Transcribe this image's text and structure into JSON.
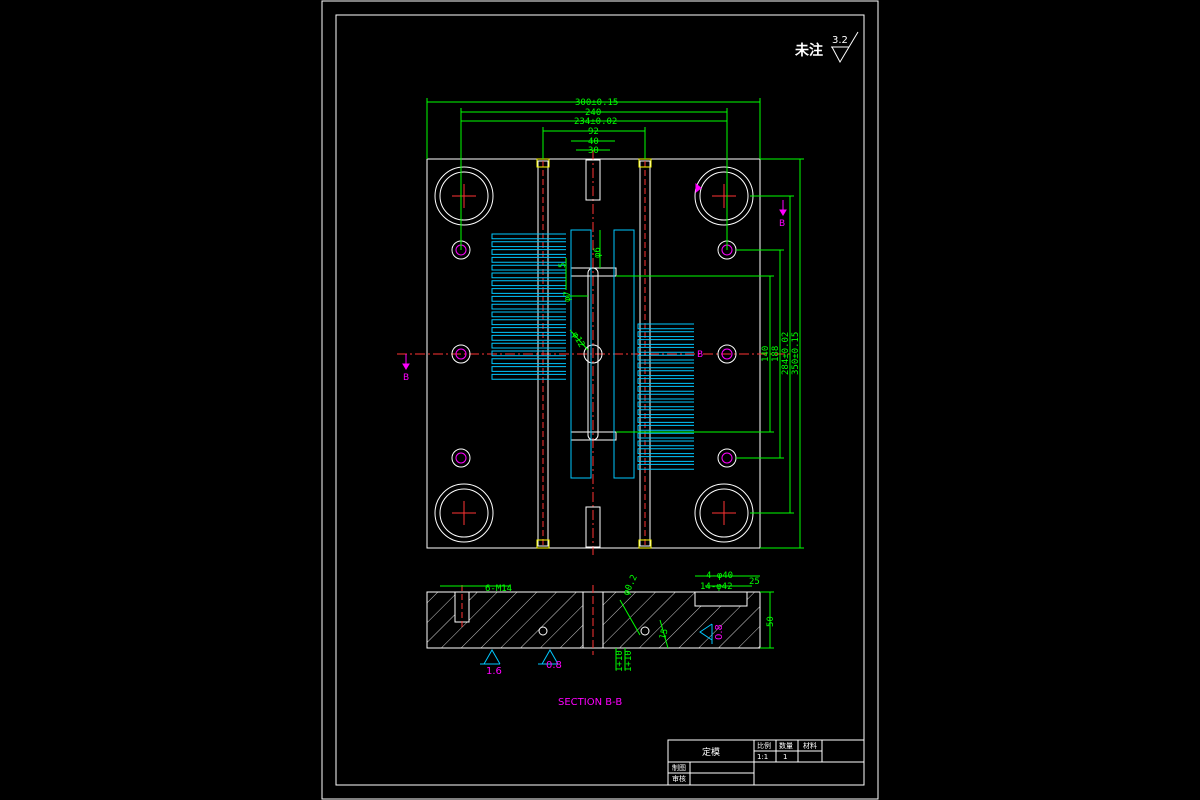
{
  "note": {
    "label": "未注",
    "roughness": "3.2"
  },
  "dims": {
    "top": [
      "300±0.15",
      "240",
      "234±0.02",
      "92",
      "40",
      "30"
    ],
    "right": [
      "140",
      "188",
      "284±0.02",
      "350±0.15"
    ],
    "phi6": "φ6",
    "phi12": "φ12",
    "five": "5",
    "phi7": "φ7",
    "section_tags": [
      "6-M14",
      "4-φ40",
      "14-φ42",
      "φ0.2",
      "15",
      "50",
      "25",
      "1+10",
      "1+10"
    ]
  },
  "section_marks": {
    "b_top": "B",
    "b_left": "B",
    "b_right": "B"
  },
  "roughness_marks": [
    "1.6",
    "0.8",
    "0.8"
  ],
  "section_title": "SECTION B-B",
  "title_block": {
    "part_name": "定模",
    "headers": [
      "比例",
      "数量",
      "材料"
    ],
    "values": [
      "1:1",
      "1"
    ],
    "rows": [
      "制图",
      "审核"
    ]
  }
}
